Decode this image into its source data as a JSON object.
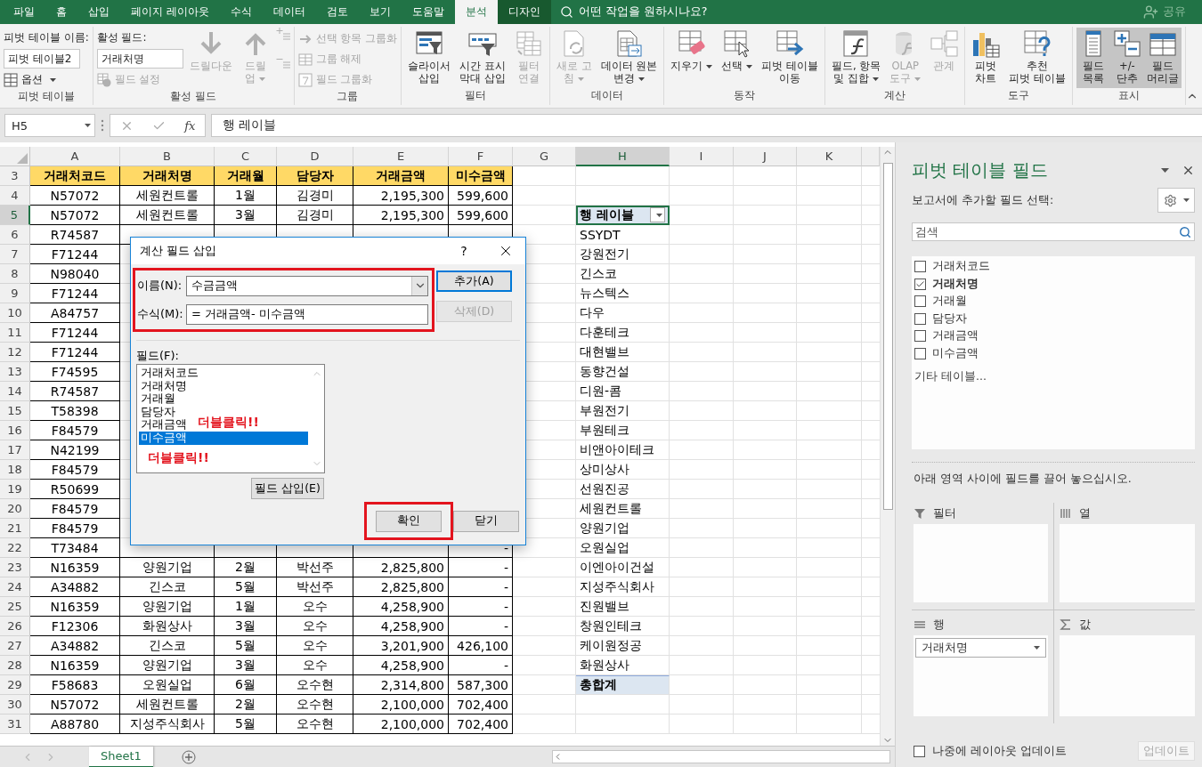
{
  "ribbon_tabs": [
    {
      "label": "파일",
      "selected": false,
      "contextual": false
    },
    {
      "label": "홈",
      "selected": false,
      "contextual": false
    },
    {
      "label": "삽입",
      "selected": false,
      "contextual": false
    },
    {
      "label": "페이지 레이아웃",
      "selected": false,
      "contextual": false
    },
    {
      "label": "수식",
      "selected": false,
      "contextual": false
    },
    {
      "label": "데이터",
      "selected": false,
      "contextual": false
    },
    {
      "label": "검토",
      "selected": false,
      "contextual": false
    },
    {
      "label": "보기",
      "selected": false,
      "contextual": false
    },
    {
      "label": "도움말",
      "selected": false,
      "contextual": false
    },
    {
      "label": "분석",
      "selected": true,
      "contextual": true
    },
    {
      "label": "디자인",
      "selected": false,
      "contextual": true
    }
  ],
  "tell_me": "어떤 작업을 원하시나요?",
  "share": "공유",
  "ribbon_groups": [
    {
      "kind": "pivot_name",
      "label": "피벗 테이블",
      "caption": "피벗 테이블 이름:",
      "value": "피벗 테이블2",
      "options": "옵션"
    },
    {
      "kind": "active_field",
      "label": "활성 필드",
      "caption": "활성 필드:",
      "value": "거래처명",
      "settings": {
        "label": "필드 설정",
        "disabled": true
      },
      "buttons": [
        {
          "label": "드릴다운",
          "disabled": true,
          "dropdown": false,
          "pressed": false
        },
        {
          "label": "드릴\n업",
          "disabled": true,
          "dropdown": true,
          "pressed": false
        }
      ]
    },
    {
      "kind": "small",
      "label": "그룹",
      "buttons": [
        {
          "label": "선택 항목 그룹화",
          "disabled": true
        },
        {
          "label": "그룹 해제",
          "disabled": true
        },
        {
          "label": "필드 그룹화",
          "disabled": true
        }
      ]
    },
    {
      "kind": "big",
      "label": "필터",
      "buttons": [
        {
          "label": "슬라이서\n삽입",
          "disabled": false,
          "dropdown": false,
          "pressed": false
        },
        {
          "label": "시간 표시\n막대 삽입",
          "disabled": false,
          "dropdown": false,
          "pressed": false
        },
        {
          "label": "필터\n연결",
          "disabled": true,
          "dropdown": false,
          "pressed": false
        }
      ]
    },
    {
      "kind": "big",
      "label": "데이터",
      "buttons": [
        {
          "label": "새로 고\n침",
          "disabled": true,
          "dropdown": true,
          "pressed": false
        },
        {
          "label": "데이터 원본\n변경",
          "disabled": false,
          "dropdown": true,
          "pressed": false
        }
      ]
    },
    {
      "kind": "big",
      "label": "동작",
      "buttons": [
        {
          "label": "지우기",
          "disabled": false,
          "dropdown": true,
          "pressed": false
        },
        {
          "label": "선택",
          "disabled": false,
          "dropdown": true,
          "pressed": false
        },
        {
          "label": "피벗 테이블\n이동",
          "disabled": false,
          "dropdown": false,
          "pressed": false
        }
      ]
    },
    {
      "kind": "big",
      "label": "계산",
      "buttons": [
        {
          "label": "필드, 항목\n및 집합",
          "disabled": false,
          "dropdown": true,
          "pressed": false
        },
        {
          "label": "OLAP\n도구",
          "disabled": true,
          "dropdown": true,
          "pressed": false
        },
        {
          "label": "관계",
          "disabled": true,
          "dropdown": false,
          "pressed": false
        }
      ]
    },
    {
      "kind": "big",
      "label": "도구",
      "buttons": [
        {
          "label": "피벗\n차트",
          "disabled": false,
          "dropdown": false,
          "pressed": false
        },
        {
          "label": "추천\n피벗 테이블",
          "disabled": false,
          "dropdown": false,
          "pressed": false
        }
      ]
    },
    {
      "kind": "big",
      "label": "표시",
      "buttons": [
        {
          "label": "필드\n목록",
          "disabled": false,
          "dropdown": false,
          "pressed": true
        },
        {
          "label": "+/-\n단추",
          "disabled": false,
          "dropdown": false,
          "pressed": true
        },
        {
          "label": "필드\n머리글",
          "disabled": false,
          "dropdown": false,
          "pressed": true
        }
      ]
    }
  ],
  "name_box": "H5",
  "fx": "fx",
  "formula": "행 레이블",
  "columns": [
    {
      "letter": "A",
      "selected": false
    },
    {
      "letter": "B",
      "selected": false
    },
    {
      "letter": "C",
      "selected": false
    },
    {
      "letter": "D",
      "selected": false
    },
    {
      "letter": "E",
      "selected": false
    },
    {
      "letter": "F",
      "selected": false
    },
    {
      "letter": "G",
      "selected": false
    },
    {
      "letter": "H",
      "selected": true
    },
    {
      "letter": "I",
      "selected": false
    },
    {
      "letter": "J",
      "selected": false
    },
    {
      "letter": "K",
      "selected": false
    }
  ],
  "rows": [
    {
      "number": "3",
      "selected": false,
      "kind": "header",
      "cells": [
        "거래처코드",
        "거래처명",
        "거래월",
        "담당자",
        "거래금액",
        "미수금액"
      ]
    },
    {
      "number": "4",
      "selected": false,
      "kind": "data",
      "cells": [
        "N57072",
        "세원컨트롤",
        "1월",
        "김경미",
        "2,195,300",
        "599,600"
      ]
    },
    {
      "number": "5",
      "selected": true,
      "kind": "data",
      "cells": [
        "N57072",
        "세원컨트롤",
        "3월",
        "김경미",
        "2,195,300",
        "599,600"
      ],
      "pivot": {
        "text": "행 레이블",
        "kind": "header"
      }
    },
    {
      "number": "6",
      "selected": false,
      "kind": "data",
      "cells": [
        "R74587",
        null,
        null,
        null,
        null,
        null
      ],
      "pivot": {
        "text": "SSYDT",
        "kind": "item"
      }
    },
    {
      "number": "7",
      "selected": false,
      "kind": "data",
      "cells": [
        "F71244"
      ],
      "pivot": {
        "text": "강원전기",
        "kind": "item"
      }
    },
    {
      "number": "8",
      "selected": false,
      "kind": "data",
      "cells": [
        "N98040"
      ],
      "pivot": {
        "text": "긴스코",
        "kind": "item"
      }
    },
    {
      "number": "9",
      "selected": false,
      "kind": "data",
      "cells": [
        "F71244"
      ],
      "pivot": {
        "text": "뉴스텍스",
        "kind": "item"
      }
    },
    {
      "number": "10",
      "selected": false,
      "kind": "data",
      "cells": [
        "A84757"
      ],
      "pivot": {
        "text": "다우",
        "kind": "item"
      }
    },
    {
      "number": "11",
      "selected": false,
      "kind": "data",
      "cells": [
        "F71244"
      ],
      "pivot": {
        "text": "다훈테크",
        "kind": "item"
      }
    },
    {
      "number": "12",
      "selected": false,
      "kind": "data",
      "cells": [
        "F71244"
      ],
      "pivot": {
        "text": "대현밸브",
        "kind": "item"
      }
    },
    {
      "number": "13",
      "selected": false,
      "kind": "data",
      "cells": [
        "F74595"
      ],
      "pivot": {
        "text": "동향건설",
        "kind": "item"
      }
    },
    {
      "number": "14",
      "selected": false,
      "kind": "data",
      "cells": [
        "R74587"
      ],
      "pivot": {
        "text": "디원-콤",
        "kind": "item"
      }
    },
    {
      "number": "15",
      "selected": false,
      "kind": "data",
      "cells": [
        "T58398"
      ],
      "pivot": {
        "text": "부원전기",
        "kind": "item"
      }
    },
    {
      "number": "16",
      "selected": false,
      "kind": "data",
      "cells": [
        "F84579"
      ],
      "pivot": {
        "text": "부원테크",
        "kind": "item"
      }
    },
    {
      "number": "17",
      "selected": false,
      "kind": "data",
      "cells": [
        "N42199"
      ],
      "pivot": {
        "text": "비앤아이테크",
        "kind": "item"
      }
    },
    {
      "number": "18",
      "selected": false,
      "kind": "data",
      "cells": [
        "F84579"
      ],
      "pivot": {
        "text": "상미상사",
        "kind": "item"
      }
    },
    {
      "number": "19",
      "selected": false,
      "kind": "data",
      "cells": [
        "R50699"
      ],
      "pivot": {
        "text": "선원진공",
        "kind": "item"
      }
    },
    {
      "number": "20",
      "selected": false,
      "kind": "data",
      "cells": [
        "F84579"
      ],
      "pivot": {
        "text": "세원컨트롤",
        "kind": "item"
      }
    },
    {
      "number": "21",
      "selected": false,
      "kind": "data",
      "cells": [
        "F84579"
      ],
      "pivot": {
        "text": "양원기업",
        "kind": "item"
      }
    },
    {
      "number": "22",
      "selected": false,
      "kind": "data",
      "cells": [
        "T73484",
        null,
        null,
        null,
        null,
        "-"
      ],
      "pivot": {
        "text": "오원실업",
        "kind": "item"
      }
    },
    {
      "number": "23",
      "selected": false,
      "kind": "data",
      "cells": [
        "N16359",
        "양원기업",
        "2월",
        "박선주",
        "2,825,800",
        "-"
      ],
      "pivot": {
        "text": "이엔아이건설",
        "kind": "item"
      }
    },
    {
      "number": "24",
      "selected": false,
      "kind": "data",
      "cells": [
        "A34882",
        "긴스코",
        "5월",
        "박선주",
        "2,825,800",
        "-"
      ],
      "pivot": {
        "text": "지성주식회사",
        "kind": "item"
      }
    },
    {
      "number": "25",
      "selected": false,
      "kind": "data",
      "cells": [
        "N16359",
        "양원기업",
        "1월",
        "오수",
        "4,258,900",
        "-"
      ],
      "pivot": {
        "text": "진원밸브",
        "kind": "item"
      }
    },
    {
      "number": "26",
      "selected": false,
      "kind": "data",
      "cells": [
        "F12306",
        "화원상사",
        "3월",
        "오수",
        "4,258,900",
        "-"
      ],
      "pivot": {
        "text": "창원인테크",
        "kind": "item"
      }
    },
    {
      "number": "27",
      "selected": false,
      "kind": "data",
      "cells": [
        "A34882",
        "긴스코",
        "5월",
        "오수",
        "3,201,900",
        "426,100"
      ],
      "pivot": {
        "text": "케이원정공",
        "kind": "item"
      }
    },
    {
      "number": "28",
      "selected": false,
      "kind": "data",
      "cells": [
        "N16359",
        "양원기업",
        "3월",
        "오수",
        "4,258,900",
        "-"
      ],
      "pivot": {
        "text": "화원상사",
        "kind": "item"
      }
    },
    {
      "number": "29",
      "selected": false,
      "kind": "data",
      "cells": [
        "F58683",
        "오원실업",
        "6월",
        "오수현",
        "2,314,800",
        "587,300"
      ],
      "pivot": {
        "text": "총합계",
        "kind": "total"
      }
    },
    {
      "number": "30",
      "selected": false,
      "kind": "data",
      "cells": [
        "N57072",
        "세원컨트롤",
        "2월",
        "오수현",
        "2,100,000",
        "702,400"
      ]
    },
    {
      "number": "31",
      "selected": false,
      "kind": "data",
      "cells": [
        "A88780",
        "지성주식회사",
        "5월",
        "오수현",
        "2,100,000",
        "702,400"
      ]
    }
  ],
  "sheet_tabs": [
    {
      "label": "Sheet1",
      "selected": true
    }
  ],
  "dialog": {
    "title": "계산 필드 삽입",
    "help": "?",
    "name_label": "이름(N):",
    "name_value": "수금금액",
    "formula_label": "수식(M):",
    "formula_value": "= 거래금액- 미수금액",
    "add": {
      "label": "추가(A)",
      "disabled": false
    },
    "delete": {
      "label": "삭제(D)",
      "disabled": true
    },
    "fields_label": "필드(F):",
    "fields": [
      {
        "label": "거래처코드",
        "selected": false
      },
      {
        "label": "거래처명",
        "selected": false
      },
      {
        "label": "거래월",
        "selected": false
      },
      {
        "label": "담당자",
        "selected": false
      },
      {
        "label": "거래금액",
        "selected": false
      },
      {
        "label": "미수금액",
        "selected": true
      }
    ],
    "insert": "필드 삽입(E)",
    "ok": "확인",
    "close": "닫기",
    "annotations": [
      "더블클릭!!",
      "더블클릭!!"
    ]
  },
  "field_pane": {
    "title": "피벗 테이블 필드",
    "prompt": "보고서에 추가할 필드 선택:",
    "search_placeholder": "검색",
    "fields": [
      {
        "label": "거래처코드",
        "checked": false
      },
      {
        "label": "거래처명",
        "checked": true
      },
      {
        "label": "거래월",
        "checked": false
      },
      {
        "label": "담당자",
        "checked": false
      },
      {
        "label": "거래금액",
        "checked": false
      },
      {
        "label": "미수금액",
        "checked": false
      }
    ],
    "more_tables": "기타 테이블...",
    "drag_hint": "아래 영역 사이에 필드를 끌어 놓으십시오.",
    "areas": [
      {
        "kind": "filter",
        "label": "필터"
      },
      {
        "kind": "columns",
        "label": "열"
      },
      {
        "kind": "rows",
        "label": "행",
        "items": [
          "거래처명"
        ]
      },
      {
        "kind": "values",
        "label": "값"
      }
    ],
    "defer": {
      "label": "나중에 레이아웃 업데이트",
      "checked": false
    },
    "update": {
      "label": "업데이트",
      "disabled": true
    }
  }
}
